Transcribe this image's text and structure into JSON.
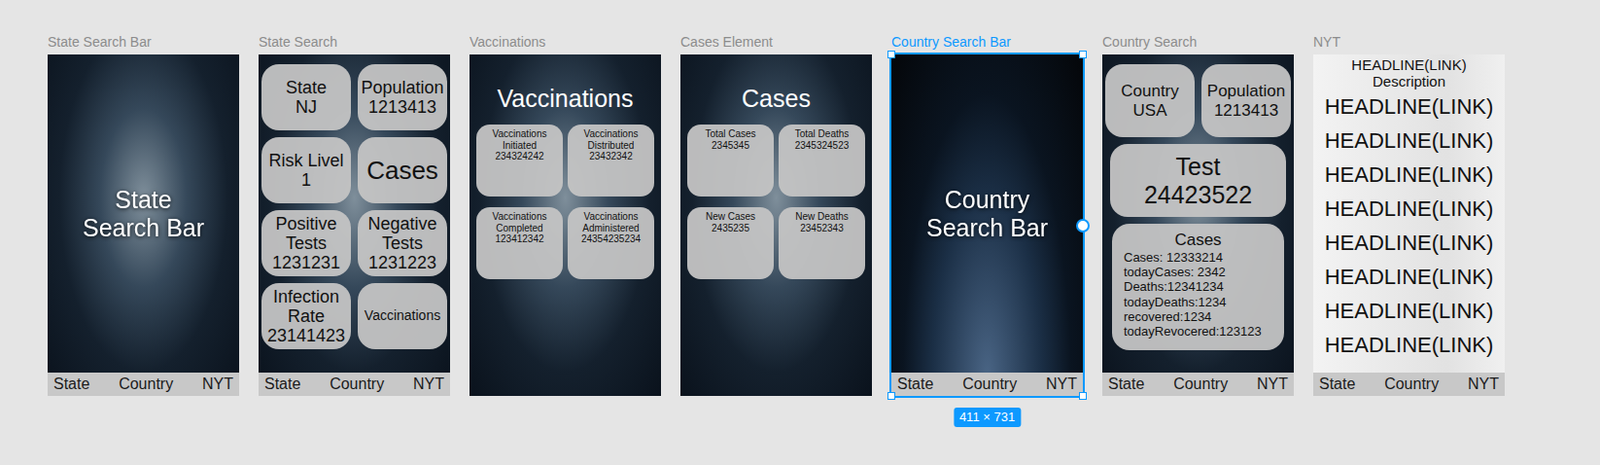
{
  "canvas": {
    "frames": [
      {
        "name": "State Search Bar",
        "selected": false,
        "kind": "search",
        "backdrop": "capitol",
        "label": "State Search Bar",
        "nav": [
          "State",
          "Country",
          "NYT"
        ]
      },
      {
        "name": "State Search",
        "selected": false,
        "kind": "tiles",
        "backdrop": "capitol",
        "tiles": [
          {
            "kind": "stat",
            "lines": [
              "State",
              "NJ"
            ]
          },
          {
            "kind": "stat",
            "lines": [
              "Population",
              "1213413"
            ]
          },
          {
            "kind": "stat",
            "lines": [
              "Risk Livel",
              "1"
            ]
          },
          {
            "kind": "link",
            "lines": [
              "Cases"
            ]
          },
          {
            "kind": "stat",
            "lines": [
              "Positive Tests",
              "1231231"
            ]
          },
          {
            "kind": "stat",
            "lines": [
              "Negative Tests",
              "1231223"
            ]
          },
          {
            "kind": "stat",
            "lines": [
              "Infection Rate",
              "23141423"
            ]
          },
          {
            "kind": "link",
            "lines": [
              "Vaccinations"
            ]
          }
        ],
        "nav": [
          "State",
          "Country",
          "NYT"
        ]
      },
      {
        "name": "Vaccinations",
        "selected": false,
        "kind": "grid",
        "backdrop": "capitol",
        "title": "Vaccinations",
        "tiles": [
          {
            "label": "Vaccinations Initiated",
            "value": "234324242"
          },
          {
            "label": "Vaccinations Distributed",
            "value": "23432342"
          },
          {
            "label": "Vaccinations Completed",
            "value": "123412342"
          },
          {
            "label": "Vaccinations Administered",
            "value": "24354235234"
          }
        ],
        "nav": []
      },
      {
        "name": "Cases Element",
        "selected": false,
        "kind": "grid",
        "backdrop": "capitol",
        "title": "Cases",
        "tiles": [
          {
            "label": "Total Cases",
            "value": "2345345"
          },
          {
            "label": "Total Deaths",
            "value": "2345324523"
          },
          {
            "label": "New Cases",
            "value": "2435235"
          },
          {
            "label": "New Deaths",
            "value": "23452343"
          }
        ],
        "nav": []
      },
      {
        "name": "Country Search Bar",
        "selected": true,
        "kind": "search",
        "backdrop": "earth",
        "label": "Country Search Bar",
        "nav": [
          "State",
          "Country",
          "NYT"
        ]
      },
      {
        "name": "Country Search",
        "selected": false,
        "kind": "country",
        "backdrop": "capitol",
        "tiles": [
          {
            "lines": [
              "Country",
              "USA"
            ]
          },
          {
            "lines": [
              "Population",
              "1213413"
            ]
          }
        ],
        "test": {
          "lines": [
            "Test",
            "24423522"
          ]
        },
        "cases": {
          "title": "Cases",
          "lines": [
            "Cases: 12333214",
            "todayCases: 2342",
            "Deaths:12341234",
            "todayDeaths:1234",
            "recovered:1234",
            "todayRevocered:123123"
          ]
        },
        "nav": [
          "State",
          "Country",
          "NYT"
        ]
      },
      {
        "name": "NYT",
        "selected": false,
        "kind": "news",
        "backdrop": "paper",
        "header": {
          "headline": "HEADLINE(LINK)",
          "description": "Description"
        },
        "headlines": [
          "HEADLINE(LINK)",
          "HEADLINE(LINK)",
          "HEADLINE(LINK)",
          "HEADLINE(LINK)",
          "HEADLINE(LINK)",
          "HEADLINE(LINK)",
          "HEADLINE(LINK)",
          "HEADLINE(LINK)"
        ],
        "nav": [
          "State",
          "Country",
          "NYT"
        ]
      }
    ],
    "selection": {
      "size": "411 × 731"
    }
  }
}
